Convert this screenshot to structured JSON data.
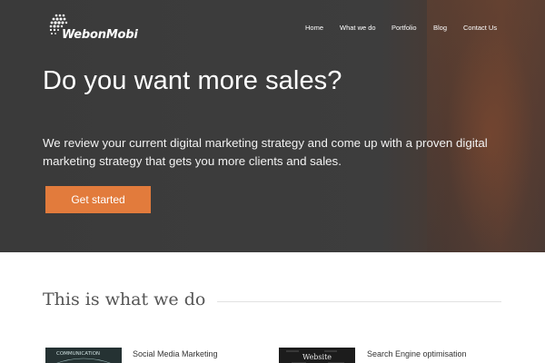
{
  "brand": {
    "name": "WebonMobi"
  },
  "nav": {
    "items": [
      {
        "label": "Home"
      },
      {
        "label": "What we do"
      },
      {
        "label": "Portfolio"
      },
      {
        "label": "Blog"
      },
      {
        "label": "Contact Us"
      }
    ]
  },
  "hero": {
    "title": "Do you want more sales?",
    "text": "We review your current digital marketing strategy and come up with a proven digital marketing strategy that gets you more clients and sales.",
    "cta_label": "Get started"
  },
  "services": {
    "title": "This is what we do",
    "items": [
      {
        "label": "Social Media Marketing",
        "thumb_text": "COMMUNICATION"
      },
      {
        "label": "Search Engine optimisation",
        "thumb_text": "Website"
      }
    ]
  },
  "colors": {
    "hero_bg": "#3b3b3b",
    "accent": "#e27b3c",
    "text_light": "#ffffff",
    "section_title": "#555555"
  },
  "icons": {
    "logo": "dotted-globe-logo"
  }
}
